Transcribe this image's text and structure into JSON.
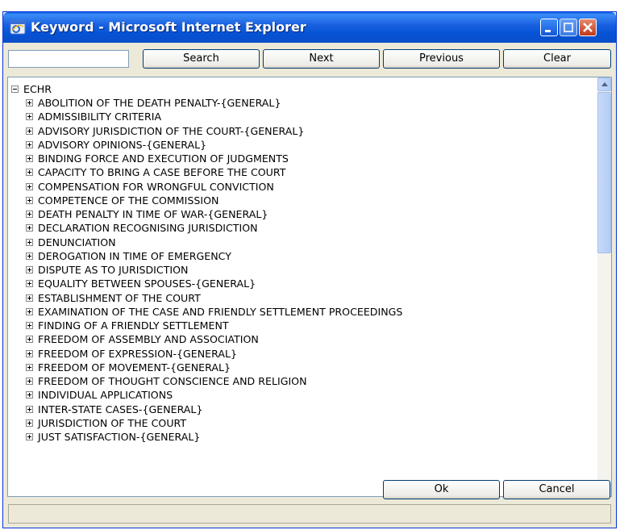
{
  "window": {
    "title": "Keyword - Microsoft Internet Explorer",
    "app_icon": "ie-icon",
    "controls": [
      "minimize-icon",
      "maximize-icon",
      "close-icon"
    ]
  },
  "toolbar": {
    "search_value": "",
    "search_label": "Search",
    "next_label": "Next",
    "previous_label": "Previous",
    "clear_label": "Clear"
  },
  "tree": {
    "root": "ECHR",
    "items": [
      "ABOLITION OF THE DEATH PENALTY-{GENERAL}",
      "ADMISSIBILITY CRITERIA",
      "ADVISORY JURISDICTION OF THE COURT-{GENERAL}",
      "ADVISORY OPINIONS-{GENERAL}",
      "BINDING FORCE AND EXECUTION OF JUDGMENTS",
      "CAPACITY TO BRING A CASE BEFORE THE COURT",
      "COMPENSATION FOR WRONGFUL CONVICTION",
      "COMPETENCE OF THE COMMISSION",
      "DEATH PENALTY IN TIME OF WAR-{GENERAL}",
      "DECLARATION RECOGNISING JURISDICTION",
      "DENUNCIATION",
      "DEROGATION IN TIME OF EMERGENCY",
      "DISPUTE AS TO JURISDICTION",
      "EQUALITY BETWEEN SPOUSES-{GENERAL}",
      "ESTABLISHMENT OF THE COURT",
      "EXAMINATION OF THE CASE AND FRIENDLY SETTLEMENT PROCEEDINGS",
      "FINDING OF A FRIENDLY SETTLEMENT",
      "FREEDOM OF ASSEMBLY AND ASSOCIATION",
      "FREEDOM OF EXPRESSION-{GENERAL}",
      "FREEDOM OF MOVEMENT-{GENERAL}",
      "FREEDOM OF THOUGHT CONSCIENCE AND RELIGION",
      "INDIVIDUAL APPLICATIONS",
      "INTER-STATE CASES-{GENERAL}",
      "JURISDICTION OF THE COURT",
      "JUST SATISFACTION-{GENERAL}"
    ]
  },
  "footer": {
    "ok_label": "Ok",
    "cancel_label": "Cancel",
    "status_text": ""
  },
  "colors": {
    "titlebar": "#0553d6",
    "window_bg": "#ece9d8",
    "button_border": "#003c74",
    "scrollbar": "#b3cbf7"
  }
}
